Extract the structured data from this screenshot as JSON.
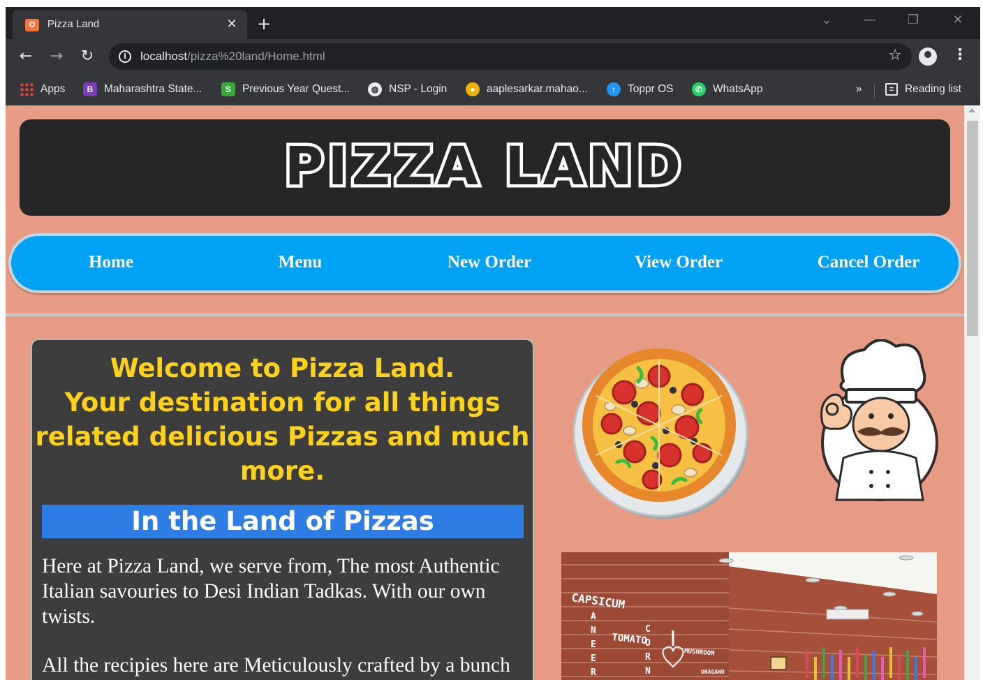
{
  "browser": {
    "tab_title": "Pizza Land",
    "tab_favicon": "XAMPP",
    "url_host": "localhost",
    "url_path": "/pizza%20land/Home.html",
    "bookmarks": [
      {
        "label": "Apps",
        "icon": "apps-grid-icon"
      },
      {
        "label": "Maharashtra State...",
        "icon": "bookmark-icon"
      },
      {
        "label": "Previous Year Quest...",
        "icon": "bookmark-icon"
      },
      {
        "label": "NSP - Login",
        "icon": "globe-icon"
      },
      {
        "label": "aaplesarkar.mahao...",
        "icon": "bookmark-icon"
      },
      {
        "label": "Toppr OS",
        "icon": "bookmark-icon"
      },
      {
        "label": "WhatsApp",
        "icon": "whatsapp-icon"
      }
    ],
    "more_bookmarks": "»",
    "reading_list": "Reading list"
  },
  "site": {
    "logo": "PIZZA LAND",
    "nav": [
      {
        "label": "Home"
      },
      {
        "label": "Menu"
      },
      {
        "label": "New Order"
      },
      {
        "label": "View Order"
      },
      {
        "label": "Cancel Order"
      }
    ],
    "welcome_lines": [
      "Welcome to Pizza Land.",
      "Your destination for all things",
      "related delicious Pizzas and much",
      "more."
    ],
    "subheading": "In the Land of Pizzas",
    "paragraph_1": "Here at Pizza Land, we serve from, The most Authentic Italian savouries to Desi Indian Tadkas. With our own twists.",
    "paragraph_2": "All the recipies here are Meticulously crafted by a bunch",
    "wall_words": [
      "CAPSICUM",
      "PANEER",
      "TOMATO",
      "CORN",
      "MUSHROOM",
      "ORAGANO"
    ]
  },
  "colors": {
    "page_bg": "#e89b84",
    "nav_bg": "#00a2f5",
    "welcome_text": "#ffd21a",
    "subhead_bg": "#2e7de4",
    "banner_bg": "#262626"
  }
}
